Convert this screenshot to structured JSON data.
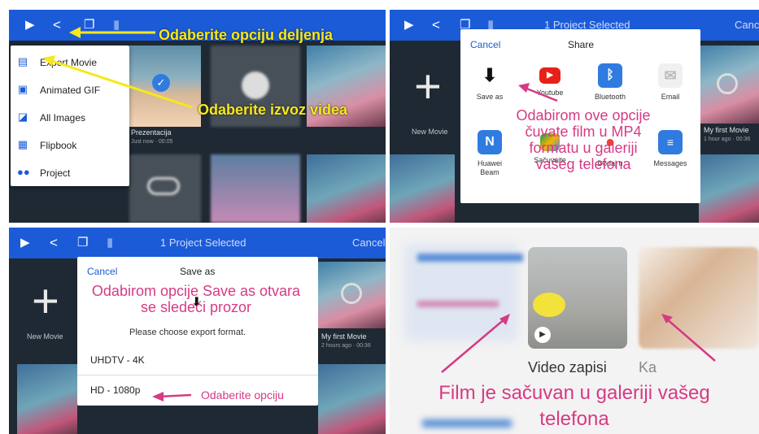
{
  "toolbar": {
    "title": "1 Project Selected",
    "cancel": "Cancel"
  },
  "panel1": {
    "menu": [
      {
        "icon": "film-icon",
        "label": "Export Movie"
      },
      {
        "icon": "gif-icon",
        "label": "Animated GIF"
      },
      {
        "icon": "images-icon",
        "label": "All Images"
      },
      {
        "icon": "book-icon",
        "label": "Flipbook"
      },
      {
        "icon": "people-icon",
        "label": "Project"
      }
    ],
    "tile_title": "Prezentacija",
    "tile_sub": "Just now · 00:05",
    "annot_share": "Odaberite opciju deljenja",
    "annot_export": "Odaberite izvoz videa"
  },
  "panel2": {
    "sheet_cancel": "Cancel",
    "sheet_title": "Share",
    "apps_row1": [
      "Save as",
      "Youtube",
      "Bluetooth",
      "Email"
    ],
    "apps_row2": [
      "Huawei Beam",
      "Sačuvaite",
      "Dodaj u",
      "Messages"
    ],
    "new_movie": "New Movie",
    "my_first_movie": "My first Movie",
    "my_first_movie_sub": "1 hour ago · 00:36",
    "annotation": [
      "Odabirom ove opcije",
      "čuvate film u MP4",
      "formatu u galeriji",
      "vašeg telefona"
    ]
  },
  "panel3": {
    "sheet_cancel": "Cancel",
    "sheet_title": "Save as",
    "prompt": "Please choose export format.",
    "formats": [
      "UHDTV - 4K",
      "HD - 1080p"
    ],
    "new_movie": "New Movie",
    "my_first_movie": "My first Movie",
    "my_first_movie_sub": "2 hours ago · 00:36",
    "annotation": [
      "Odabirom opcije Save as otvara",
      "se sledeći prozor"
    ],
    "annot_choose": "Odaberite opciju"
  },
  "panel4": {
    "album1": "Video zapisi",
    "album2": "Ka",
    "caption": [
      "Film je sačuvan u galeriji vašeg",
      "telefona"
    ]
  },
  "colors": {
    "toolbar_blue": "#1c5bd8",
    "annotation_yellow": "#f6e81b",
    "annotation_pink": "#d63a85"
  }
}
